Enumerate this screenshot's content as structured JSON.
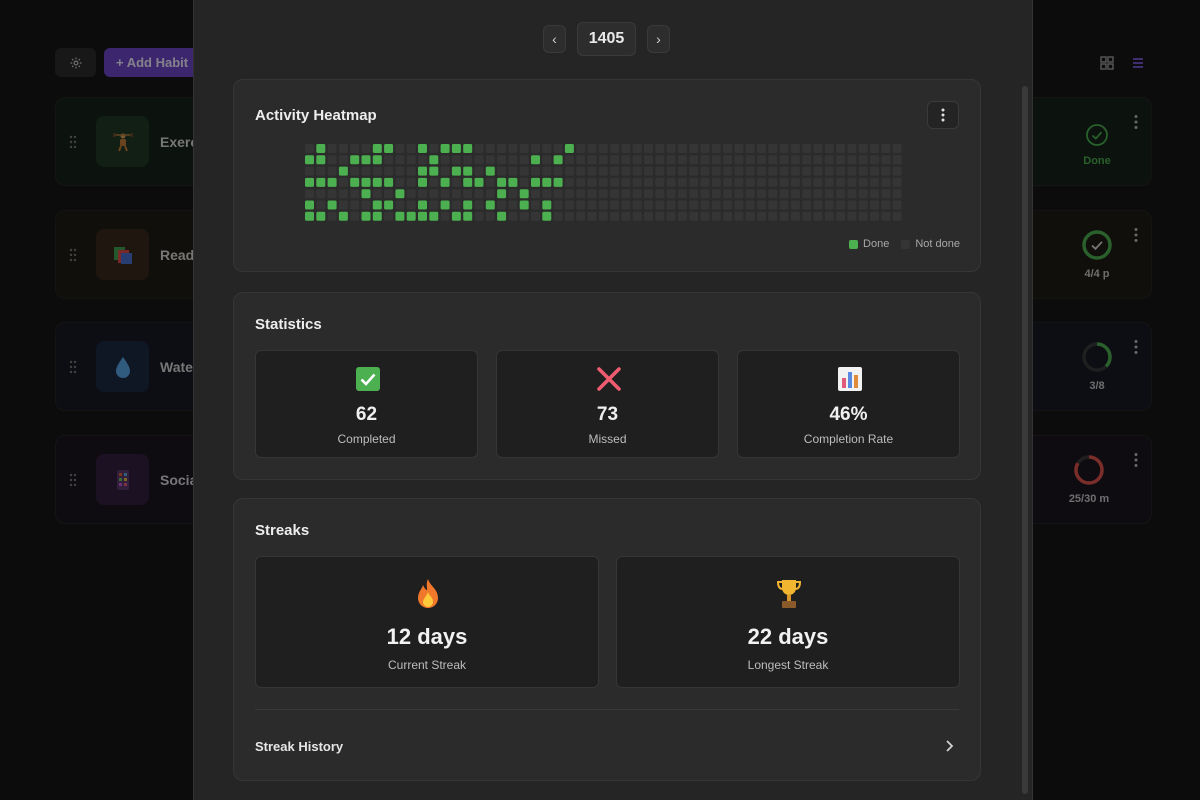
{
  "colors": {
    "accent": "#6d45c9",
    "done": "#4caf50",
    "not_done": "#353535",
    "missed": "#ef5b6f",
    "streak_red": "#e0524c"
  },
  "toolbar": {
    "settings_icon": "gear-icon",
    "add_habit_label": "+ Add Habit",
    "view_icons": [
      "grid-icon",
      "list-icon"
    ]
  },
  "habits": [
    {
      "name": "Exerc",
      "icon": "weightlifter-icon",
      "status_text": "Done",
      "status_icon": "check-circle-icon",
      "progress": 1.0
    },
    {
      "name": "Readi",
      "icon": "books-icon",
      "status_text": "4/4 p",
      "status_icon": "check-circle-icon",
      "progress": 1.0
    },
    {
      "name": "Wate",
      "icon": "water-drop-icon",
      "status_text": "3/8",
      "status_icon": "progress-ring-icon",
      "progress": 0.375
    },
    {
      "name": "Socia",
      "icon": "phone-icon",
      "status_text": "25/30 m",
      "status_icon": "progress-ring-icon",
      "progress": 0.833
    }
  ],
  "modal": {
    "year_nav": {
      "prev": "‹",
      "year": "1405",
      "next": "›"
    },
    "heatmap": {
      "title": "Activity Heatmap",
      "menu_icon": "vertical-dots-icon",
      "weeks": 53,
      "days": 7,
      "done_cells": [
        [
          0,
          1
        ],
        [
          0,
          3
        ],
        [
          0,
          5
        ],
        [
          0,
          6
        ],
        [
          1,
          0
        ],
        [
          1,
          1
        ],
        [
          1,
          3
        ],
        [
          1,
          6
        ],
        [
          2,
          3
        ],
        [
          2,
          5
        ],
        [
          3,
          2
        ],
        [
          3,
          6
        ],
        [
          4,
          1
        ],
        [
          4,
          3
        ],
        [
          5,
          1
        ],
        [
          5,
          3
        ],
        [
          5,
          4
        ],
        [
          5,
          6
        ],
        [
          6,
          0
        ],
        [
          6,
          1
        ],
        [
          6,
          3
        ],
        [
          6,
          5
        ],
        [
          6,
          6
        ],
        [
          7,
          0
        ],
        [
          7,
          3
        ],
        [
          7,
          5
        ],
        [
          8,
          4
        ],
        [
          8,
          6
        ],
        [
          9,
          6
        ],
        [
          10,
          0
        ],
        [
          10,
          2
        ],
        [
          10,
          3
        ],
        [
          10,
          5
        ],
        [
          10,
          6
        ],
        [
          11,
          1
        ],
        [
          11,
          2
        ],
        [
          11,
          6
        ],
        [
          12,
          0
        ],
        [
          12,
          3
        ],
        [
          12,
          5
        ],
        [
          13,
          0
        ],
        [
          13,
          2
        ],
        [
          13,
          6
        ],
        [
          14,
          0
        ],
        [
          14,
          2
        ],
        [
          14,
          3
        ],
        [
          14,
          5
        ],
        [
          14,
          6
        ],
        [
          15,
          3
        ],
        [
          16,
          2
        ],
        [
          16,
          5
        ],
        [
          17,
          3
        ],
        [
          17,
          4
        ],
        [
          17,
          6
        ],
        [
          18,
          3
        ],
        [
          19,
          4
        ],
        [
          19,
          5
        ],
        [
          20,
          1
        ],
        [
          20,
          3
        ],
        [
          21,
          3
        ],
        [
          21,
          5
        ],
        [
          21,
          6
        ],
        [
          22,
          1
        ],
        [
          22,
          3
        ],
        [
          23,
          0
        ]
      ],
      "legend_done": "Done",
      "legend_not_done": "Not done"
    },
    "statistics": {
      "title": "Statistics",
      "completed_value": "62",
      "completed_label": "Completed",
      "completed_icon": "check-box-icon",
      "missed_value": "73",
      "missed_label": "Missed",
      "missed_icon": "cross-icon",
      "rate_value": "46%",
      "rate_label": "Completion Rate",
      "rate_icon": "bar-chart-icon"
    },
    "streaks": {
      "title": "Streaks",
      "current_value": "12 days",
      "current_label": "Current Streak",
      "current_icon": "fire-icon",
      "longest_value": "22 days",
      "longest_label": "Longest Streak",
      "longest_icon": "trophy-icon",
      "history_label": "Streak History",
      "history_icon": "chevron-right-icon"
    }
  }
}
